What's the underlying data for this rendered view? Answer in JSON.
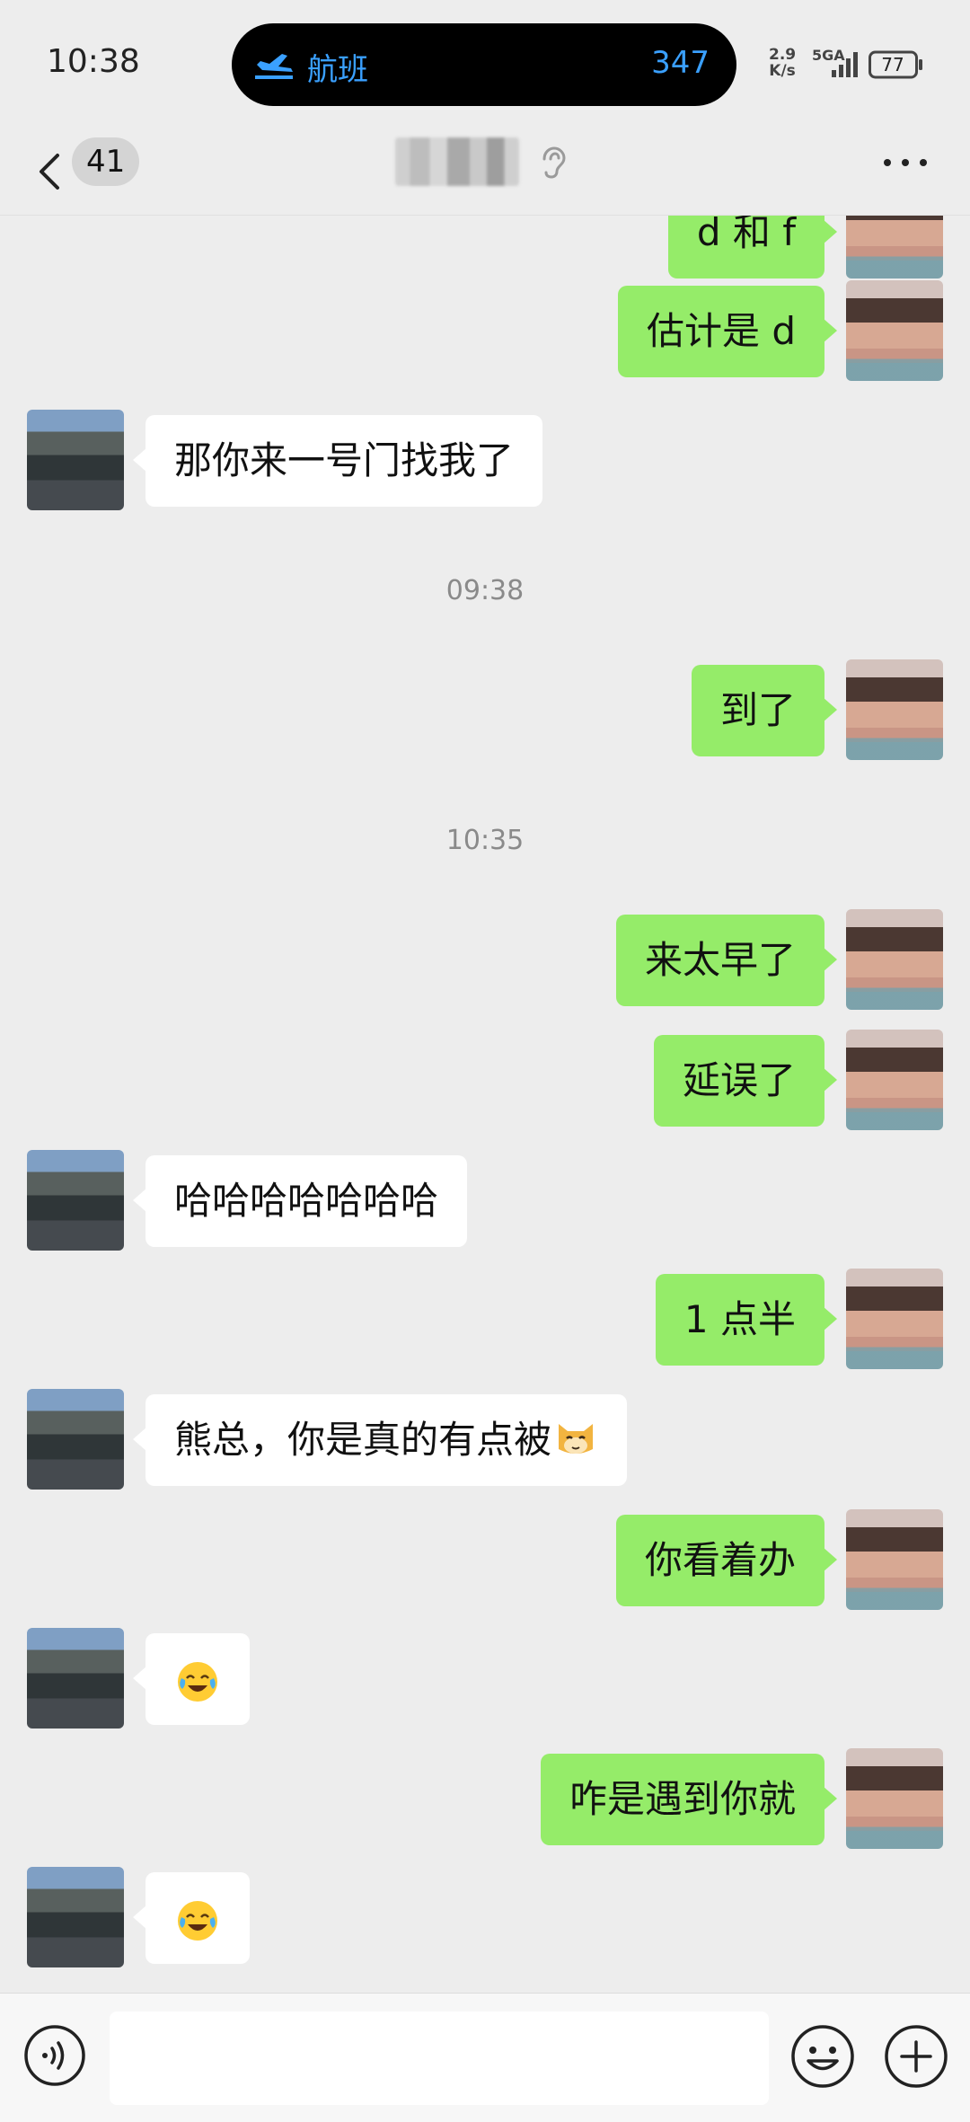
{
  "status_bar": {
    "time": "10:38",
    "island_label": "航班",
    "island_count": "347",
    "net_speed_value": "2.9",
    "net_speed_unit": "K/s",
    "network_type": "5GA",
    "battery_level": "77"
  },
  "header": {
    "unread_count": "41",
    "contact_name": ""
  },
  "messages": [
    {
      "side": "me",
      "text": "d 和 f"
    },
    {
      "side": "me",
      "text": "估计是 d"
    },
    {
      "side": "them",
      "text": "那你来一号门找我了"
    },
    {
      "type": "time",
      "text": "09:38"
    },
    {
      "side": "me",
      "text": "到了"
    },
    {
      "type": "time",
      "text": "10:35"
    },
    {
      "side": "me",
      "text": "来太早了"
    },
    {
      "side": "me",
      "text": "延误了"
    },
    {
      "side": "them",
      "text": "哈哈哈哈哈哈哈"
    },
    {
      "side": "me",
      "text": "1 点半"
    },
    {
      "side": "them",
      "text": "熊总，你是真的有点被",
      "emoji": "cat-face-emoji"
    },
    {
      "side": "me",
      "text": "你看着办"
    },
    {
      "side": "them",
      "text": "",
      "emoji": "laughing-crying-emoji"
    },
    {
      "side": "me",
      "text": "咋是遇到你就"
    },
    {
      "side": "them",
      "text": "",
      "emoji": "laughing-crying-emoji"
    }
  ],
  "input_bar": {
    "placeholder": ""
  },
  "colors": {
    "my_bubble": "#95ec69",
    "their_bubble": "#ffffff",
    "background": "#ededed",
    "island_accent": "#3aa0ff"
  }
}
